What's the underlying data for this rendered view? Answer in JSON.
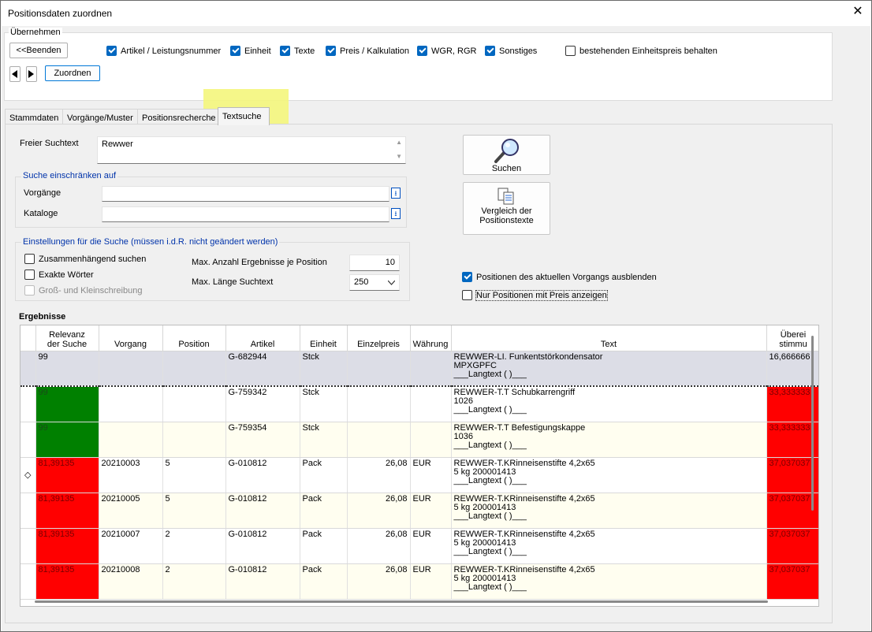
{
  "window": {
    "title": "Positionsdaten zuordnen",
    "close": "✕"
  },
  "uebernehmen": {
    "title": "Übernehmen",
    "beenden": "<<Beenden",
    "zuordnen": "Zuordnen",
    "checkboxes": [
      {
        "label": "Artikel / Leistungsnummer",
        "checked": true
      },
      {
        "label": "Einheit",
        "checked": true
      },
      {
        "label": "Texte",
        "checked": true
      },
      {
        "label": "Preis / Kalkulation",
        "checked": true
      },
      {
        "label": "WGR, RGR",
        "checked": true
      },
      {
        "label": "Sonstiges",
        "checked": true
      },
      {
        "label": "bestehenden Einheitspreis behalten",
        "checked": false
      }
    ]
  },
  "tabs": [
    "Stammdaten",
    "Vorgänge/Muster",
    "Positionsrecherche",
    "Textsuche"
  ],
  "active_tab": "Textsuche",
  "search": {
    "freier_label": "Freier Suchtext",
    "freier_value": "Rewwer",
    "einschraenken_title": "Suche einschränken auf",
    "vorgaenge_label": "Vorgänge",
    "kataloge_label": "Kataloge",
    "einstellungen_title": "Einstellungen für die Suche (müssen i.d.R. nicht geändert werden)",
    "zusammen": "Zusammenhängend suchen",
    "exakte": "Exakte Wörter",
    "gross": "Groß- und Kleinschreibung",
    "max_anzahl_label": "Max. Anzahl Ergebnisse je Position",
    "max_anzahl_value": "10",
    "max_laenge_label": "Max. Länge Suchtext",
    "max_laenge_value": "250",
    "suchen_button": "Suchen",
    "vergleich_button_1": "Vergleich der",
    "vergleich_button_2": "Positionstexte",
    "ausblenden": "Positionen des aktuellen Vorgangs ausblenden",
    "nur_preis": "Nur Positionen mit Preis anzeigen"
  },
  "results": {
    "title": "Ergebnisse",
    "headers": [
      "Relevanz der Suche",
      "Vorgang",
      "Position",
      "Artikel",
      "Einheit",
      "Einzelpreis",
      "Währung",
      "Text",
      "Überein-stimmung"
    ],
    "header_relevanz_1": "Relevanz",
    "header_relevanz_2": "der Suche",
    "header_ueber_1": "Überei",
    "header_ueber_2": "stimmu",
    "rows": [
      {
        "indicator": "",
        "relevanz": "99",
        "vorgang": "",
        "position": "",
        "artikel": "G-682944",
        "einheit": "Stck",
        "preis": "",
        "waehrung": "",
        "text1": "REWWER-LI. Funkentstörkondensator",
        "text2": "MPXGPFC",
        "text3": "___Langtext ( )___",
        "ueber": "16,666666",
        "color": "none",
        "style": "sel"
      },
      {
        "indicator": "",
        "relevanz": "99",
        "vorgang": "",
        "position": "",
        "artikel": "G-759342",
        "einheit": "Stck",
        "preis": "",
        "waehrung": "",
        "text1": "REWWER-T.T Schubkarrengriff",
        "text2": "1026",
        "text3": "___Langtext ( )___",
        "ueber": "33,333333",
        "color": "green",
        "style": "even"
      },
      {
        "indicator": "",
        "relevanz": "99",
        "vorgang": "",
        "position": "",
        "artikel": "G-759354",
        "einheit": "Stck",
        "preis": "",
        "waehrung": "",
        "text1": "REWWER-T.T Befestigungskappe",
        "text2": "1036",
        "text3": "___Langtext ( )___",
        "ueber": "33,333333",
        "color": "green",
        "style": "odd"
      },
      {
        "indicator": "◇",
        "relevanz": "81,39135",
        "vorgang": "20210003",
        "position": "5",
        "artikel": "G-010812",
        "einheit": "Pack",
        "preis": "26,08",
        "waehrung": "EUR",
        "text1": "REWWER-T.KRinneisenstifte 4,2x65",
        "text2": "5 kg 200001413",
        "text3": "___Langtext ( )___",
        "ueber": "37,037037",
        "color": "red",
        "style": "even"
      },
      {
        "indicator": "",
        "relevanz": "81,39135",
        "vorgang": "20210005",
        "position": "5",
        "artikel": "G-010812",
        "einheit": "Pack",
        "preis": "26,08",
        "waehrung": "EUR",
        "text1": "REWWER-T.KRinneisenstifte 4,2x65",
        "text2": "5 kg 200001413",
        "text3": "___Langtext ( )___",
        "ueber": "37,037037",
        "color": "red",
        "style": "odd"
      },
      {
        "indicator": "",
        "relevanz": "81,39135",
        "vorgang": "20210007",
        "position": "2",
        "artikel": "G-010812",
        "einheit": "Pack",
        "preis": "26,08",
        "waehrung": "EUR",
        "text1": "REWWER-T.KRinneisenstifte 4,2x65",
        "text2": "5 kg 200001413",
        "text3": "___Langtext ( )___",
        "ueber": "37,037037",
        "color": "red",
        "style": "even"
      },
      {
        "indicator": "",
        "relevanz": "81,39135",
        "vorgang": "20210008",
        "position": "2",
        "artikel": "G-010812",
        "einheit": "Pack",
        "preis": "26,08",
        "waehrung": "EUR",
        "text1": "REWWER-T.KRinneisenstifte 4,2x65",
        "text2": "5 kg 200001413",
        "text3": "___Langtext ( )___",
        "ueber": "37,037037",
        "color": "red",
        "style": "odd"
      }
    ]
  },
  "colors": {
    "highlight": "#f4f67c",
    "check": "#0067c0",
    "relevance_green": "#008000",
    "relevance_red": "#ff0000",
    "group_title": "#0033aa"
  }
}
